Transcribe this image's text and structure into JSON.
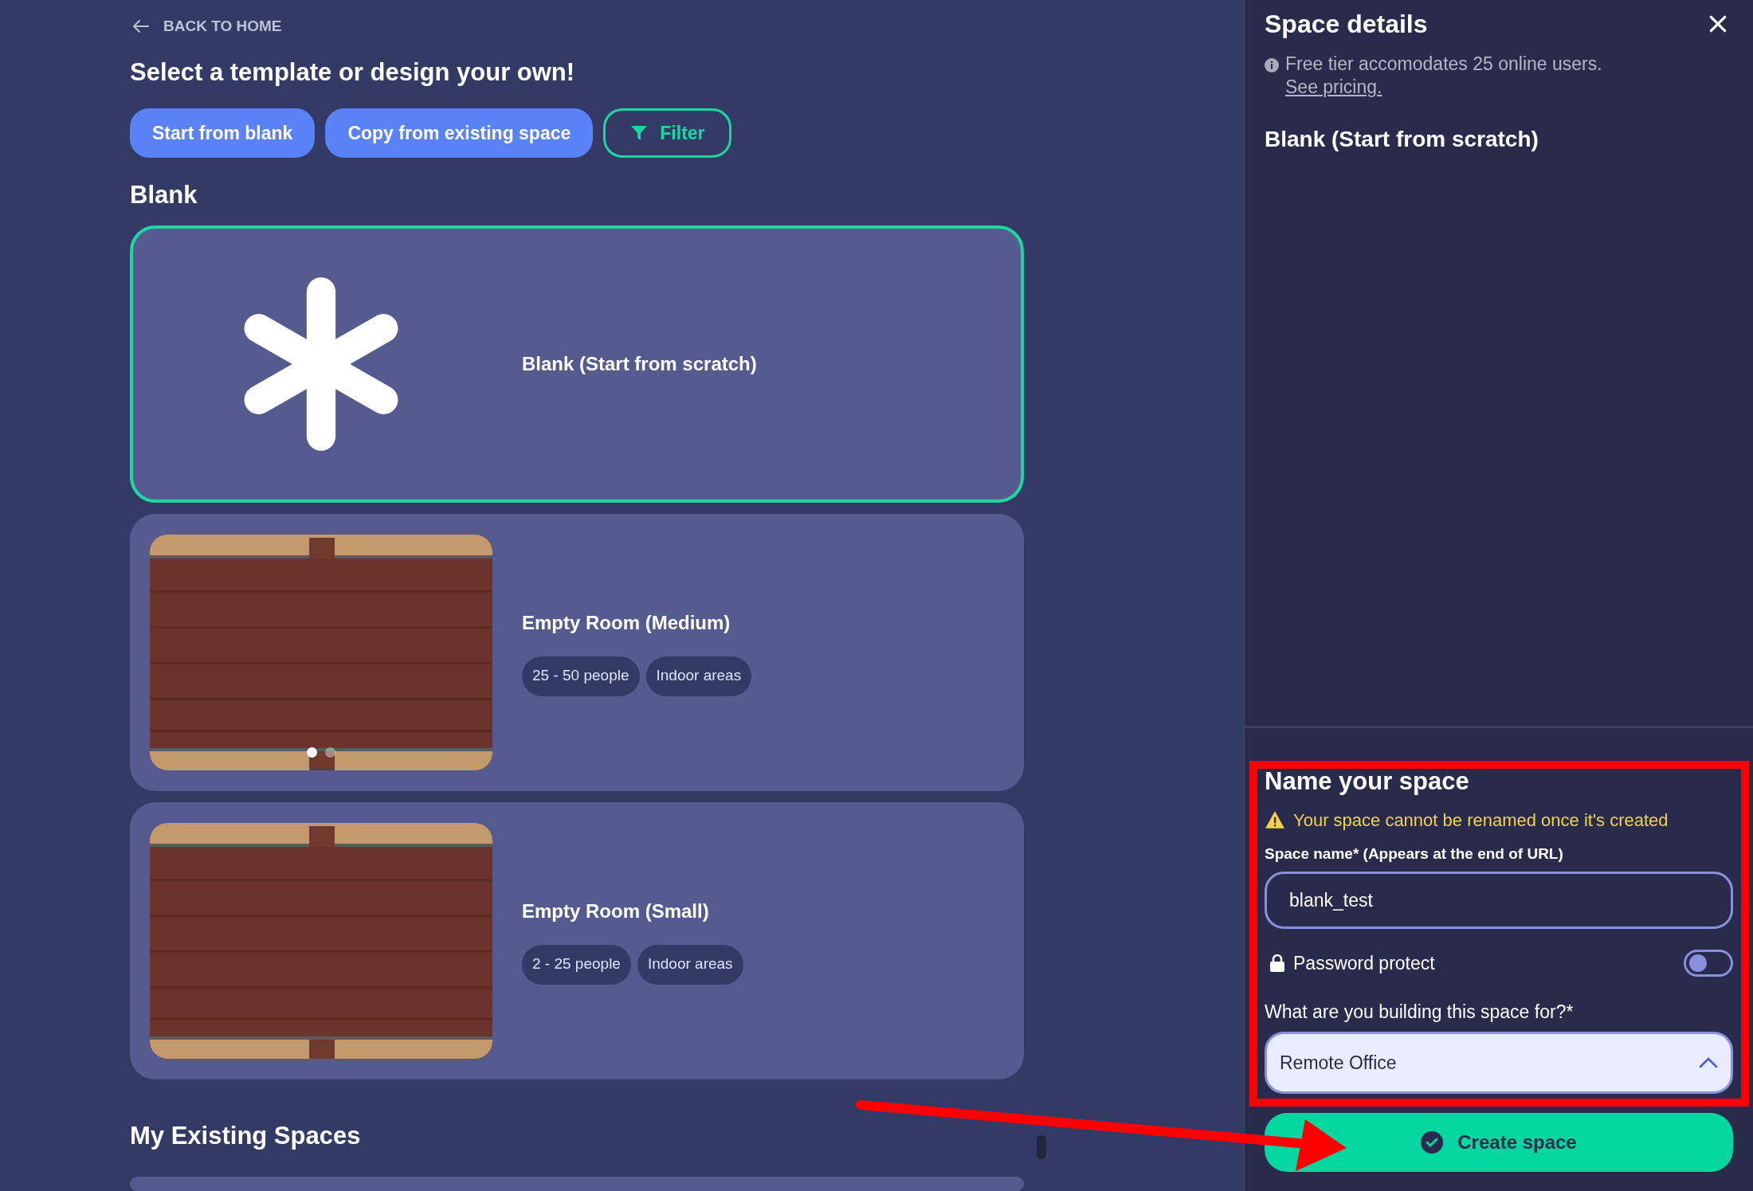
{
  "back_link": "BACK TO HOME",
  "heading": "Select a template or design your own!",
  "actions": [
    {
      "label": "Start from blank",
      "kind": "primary"
    },
    {
      "label": "Copy from existing space",
      "kind": "primary"
    },
    {
      "label": "Filter",
      "kind": "outline"
    }
  ],
  "blank_section": {
    "title": "Blank"
  },
  "templates": [
    {
      "kind": "blank",
      "title": "Blank (Start from scratch)",
      "selected": true
    },
    {
      "kind": "room",
      "title": "Empty Room (Medium)",
      "selected": false,
      "tags": [
        "25 - 50 people",
        "Indoor areas"
      ],
      "slide_dots": [
        {
          "selected": true
        },
        {
          "selected": false
        }
      ]
    },
    {
      "kind": "room",
      "title": "Empty Room (Small)",
      "selected": false,
      "tags": [
        "2 - 25 people",
        "Indoor areas"
      ]
    }
  ],
  "existing_section": {
    "title": "My Existing Spaces"
  },
  "panel": {
    "title": "Space details",
    "info": "Free tier accomodates 25 online users.",
    "info_link": "See pricing.",
    "selected_template": "Blank (Start from scratch)"
  },
  "form": {
    "title": "Name your space",
    "warning": "Your space cannot be renamed once it's created",
    "name_label": "Space name* (Appears at the end of URL)",
    "name_value": "blank_test",
    "password_label": "Password protect",
    "password_on": false,
    "purpose_label": "What are you building this space for?*",
    "purpose_value": "Remote Office",
    "purpose_expanded": true,
    "submit": "Create space"
  }
}
